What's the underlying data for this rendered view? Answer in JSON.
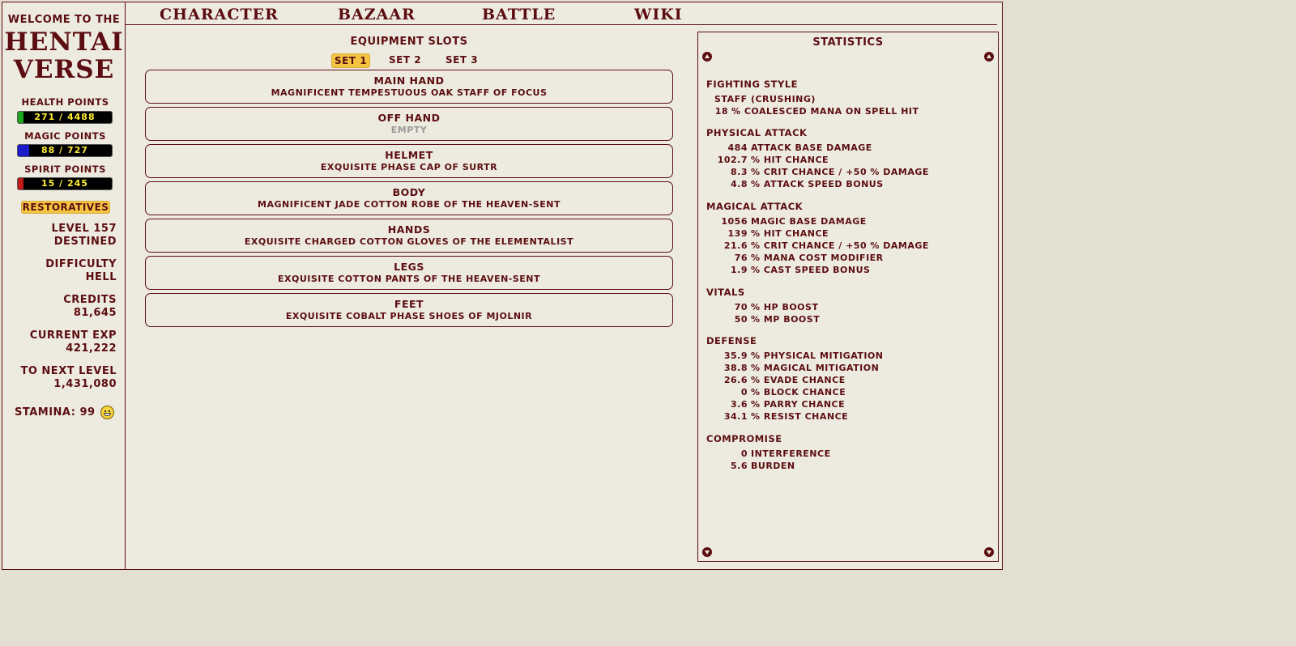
{
  "left": {
    "welcome": "Welcome to the",
    "logo_line1": "HENTAI",
    "logo_line2": "VERSE",
    "health_label": "Health points",
    "health_value": "271 / 4488",
    "health_ratio": 0.0604,
    "magic_label": "Magic points",
    "magic_value": "88 / 727",
    "magic_ratio": 0.121,
    "spirit_label": "Spirit points",
    "spirit_value": "15 / 245",
    "spirit_ratio": 0.061,
    "restoratives": "Restoratives",
    "level": "Level 157",
    "title": "Destined",
    "difficulty_label": "Difficulty",
    "difficulty": "Hell",
    "credits_label": "Credits",
    "credits": "81,645",
    "exp_label": "Current EXP",
    "exp": "421,222",
    "next_label": "To Next Level",
    "next": "1,431,080",
    "stamina": "Stamina: 99",
    "colors": {
      "health": "#1fa81f",
      "magic": "#1b1bcc",
      "spirit": "#c21b1b",
      "accent": "#f5c542"
    }
  },
  "menu": [
    "Character",
    "Bazaar",
    "Battle",
    "Wiki"
  ],
  "equipment": {
    "title": "Equipment Slots",
    "sets": [
      "Set 1",
      "Set 2",
      "Set 3"
    ],
    "slots": [
      {
        "name": "Main Hand",
        "item": "Magnificent Tempestuous Oak Staff of Focus"
      },
      {
        "name": "Off Hand",
        "item": "Empty"
      },
      {
        "name": "Helmet",
        "item": "Exquisite Phase Cap of Surtr"
      },
      {
        "name": "Body",
        "item": "Magnificent Jade Cotton Robe of the Heaven-sent"
      },
      {
        "name": "Hands",
        "item": "Exquisite Charged Cotton Gloves of the Elementalist"
      },
      {
        "name": "Legs",
        "item": "Exquisite Cotton Pants of the Heaven-sent"
      },
      {
        "name": "Feet",
        "item": "Exquisite Cobalt Phase Shoes of Mjolnir"
      }
    ]
  },
  "stats": {
    "title": "Statistics",
    "fighting_style": {
      "heading": "Fighting Style",
      "style": "Staff (Crushing)",
      "bonus_value": "18",
      "bonus": "% Coalesced Mana on Spell Hit"
    },
    "physical": {
      "heading": "Physical Attack",
      "rows": [
        {
          "v": "484",
          "l": "Attack Base Damage"
        },
        {
          "v": "102.7",
          "l": "% Hit Chance"
        },
        {
          "v": "8.3",
          "l": "% Crit Chance / +50 % Damage"
        },
        {
          "v": "4.8",
          "l": "% Attack Speed Bonus"
        }
      ]
    },
    "magical": {
      "heading": "Magical Attack",
      "rows": [
        {
          "v": "1056",
          "l": "Magic Base Damage"
        },
        {
          "v": "139",
          "l": "% Hit Chance"
        },
        {
          "v": "21.6",
          "l": "% Crit Chance / +50 % Damage"
        },
        {
          "v": "76",
          "l": "% Mana Cost Modifier"
        },
        {
          "v": "1.9",
          "l": "% Cast Speed Bonus"
        }
      ]
    },
    "vitals": {
      "heading": "Vitals",
      "rows": [
        {
          "v": "70",
          "l": "% HP Boost"
        },
        {
          "v": "50",
          "l": "% MP Boost"
        }
      ]
    },
    "defense": {
      "heading": "Defense",
      "rows": [
        {
          "v": "35.9",
          "l": "% Physical Mitigation"
        },
        {
          "v": "38.8",
          "l": "% Magical Mitigation"
        },
        {
          "v": "26.6",
          "l": "% Evade Chance"
        },
        {
          "v": "0",
          "l": "% Block Chance"
        },
        {
          "v": "3.6",
          "l": "% Parry Chance"
        },
        {
          "v": "34.1",
          "l": "% Resist Chance"
        }
      ]
    },
    "compromise": {
      "heading": "Compromise",
      "rows": [
        {
          "v": "0",
          "l": "Interference"
        },
        {
          "v": "5.6",
          "l": "Burden"
        }
      ]
    }
  }
}
